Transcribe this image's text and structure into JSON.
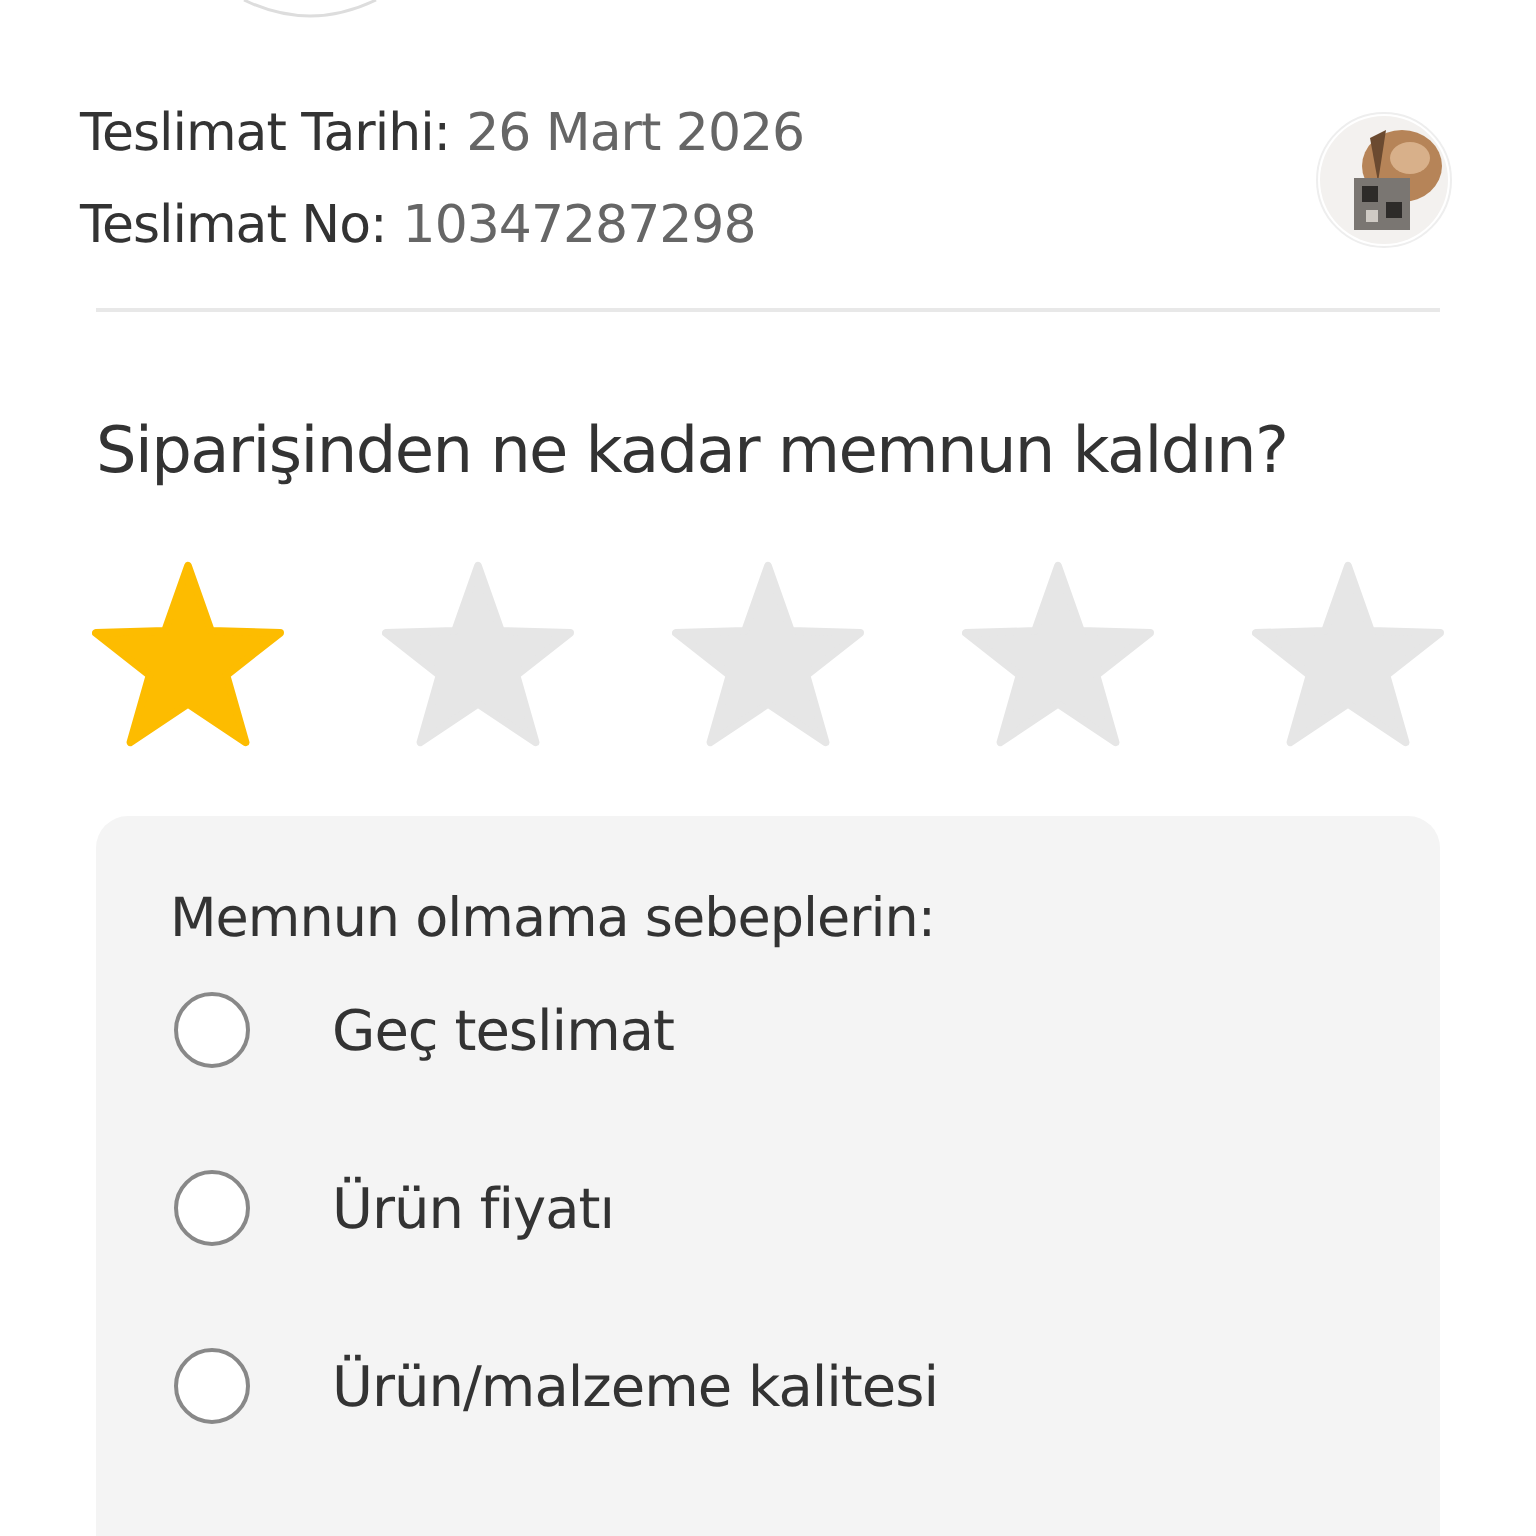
{
  "delivery": {
    "date_label": "Teslimat Tarihi:",
    "date": "26 Mart 2026",
    "number_label": "Teslimat No:",
    "number": "10347287298"
  },
  "question": "Siparişinden ne kadar memnun kaldın?",
  "rating": {
    "stars": 1
  },
  "reasons": {
    "title": "Memnun olmama sebeplerin:",
    "options": [
      {
        "label": "Geç teslimat",
        "selected": false
      },
      {
        "label": "Ürün fiyatı",
        "selected": false
      },
      {
        "label": "Ürün/malzeme kalitesi",
        "selected": false
      }
    ]
  }
}
